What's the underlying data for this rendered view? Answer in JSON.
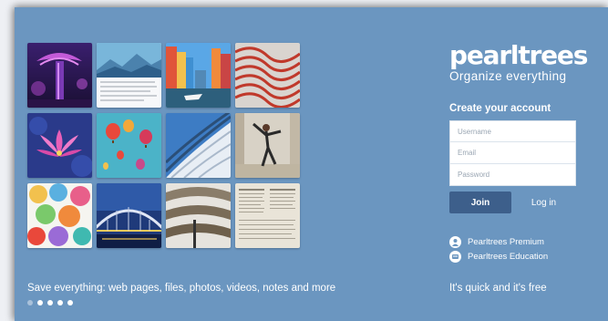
{
  "brand": {
    "logo": "pearltrees",
    "slogan": "Organize everything"
  },
  "signup": {
    "title": "Create your account",
    "username_placeholder": "Username",
    "email_placeholder": "Email",
    "password_placeholder": "Password",
    "join_label": "Join",
    "login_label": "Log in"
  },
  "links": {
    "premium": "Pearltrees Premium",
    "education": "Pearltrees Education"
  },
  "footer": {
    "tagline": "Save everything: web pages, files, photos, videos, notes and more",
    "quick": "It's quick and it's free"
  },
  "carousel": {
    "dot_count": 5,
    "active_index": 0
  },
  "gallery": [
    {
      "name": "supertree-photo"
    },
    {
      "name": "mountain-article-photo"
    },
    {
      "name": "canal-houses-photo"
    },
    {
      "name": "red-wave-architecture-photo"
    },
    {
      "name": "lotus-flower-photo"
    },
    {
      "name": "hot-air-balloons-photo"
    },
    {
      "name": "curved-building-photo"
    },
    {
      "name": "dancer-photo"
    },
    {
      "name": "umbrellas-photo"
    },
    {
      "name": "bridge-night-photo"
    },
    {
      "name": "library-photo"
    },
    {
      "name": "newspaper-photo"
    }
  ],
  "colors": {
    "panel": "#6b96c0",
    "join_button": "#3d5f8b",
    "text": "#ffffff"
  }
}
